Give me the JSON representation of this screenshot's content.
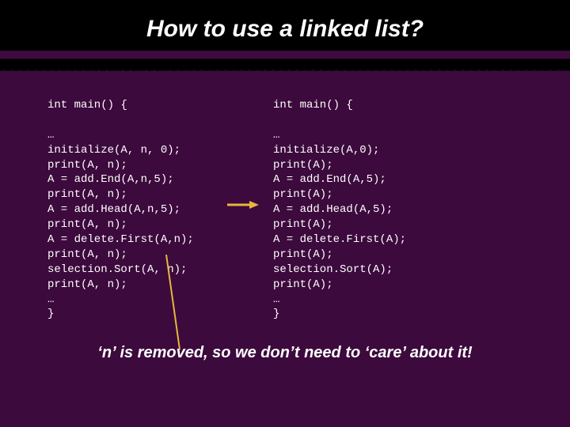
{
  "title": "How to use a linked list?",
  "code_left": "int main() {\n\n…\ninitialize(A, n, 0);\nprint(A, n);\nA = add.End(A,n,5);\nprint(A, n);\nA = add.Head(A,n,5);\nprint(A, n);\nA = delete.First(A,n);\nprint(A, n);\nselection.Sort(A, n);\nprint(A, n);\n…\n}",
  "code_right": "int main() {\n\n…\ninitialize(A,0);\nprint(A);\nA = add.End(A,5);\nprint(A);\nA = add.Head(A,5);\nprint(A);\nA = delete.First(A);\nprint(A);\nselection.Sort(A);\nprint(A);\n…\n}",
  "caption": "‘n’ is removed, so we don’t need to ‘care’ about it!"
}
